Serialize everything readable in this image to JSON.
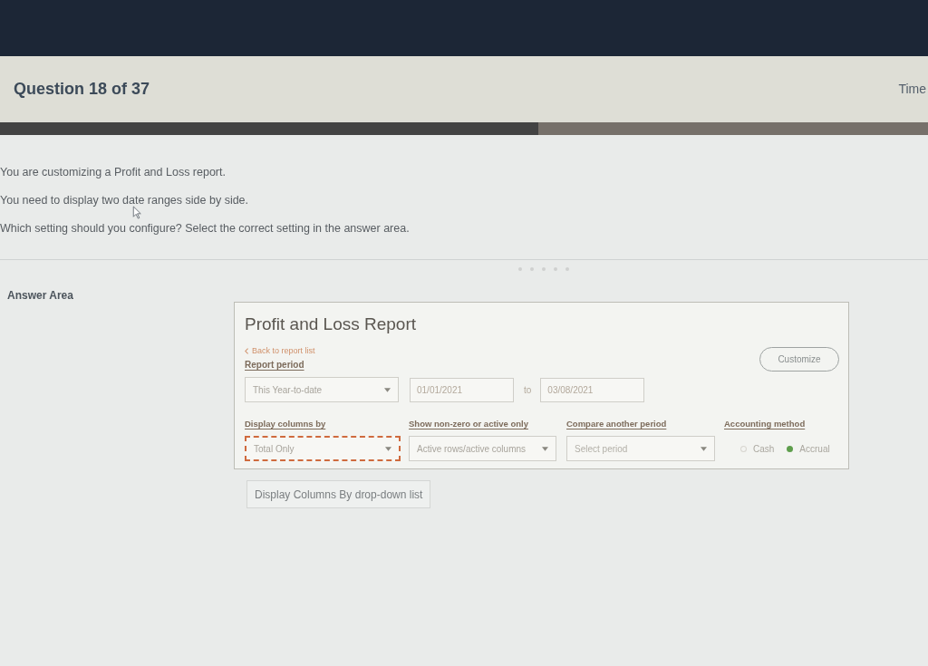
{
  "header": {
    "question": "Question 18 of 37",
    "timer_label": "Time"
  },
  "progress": {
    "level": 0.58
  },
  "question_lines": [
    "You are customizing a Profit and Loss report.",
    "You need to display two date ranges side by side.",
    "Which setting should you configure? Select the correct setting in the answer area."
  ],
  "answer_area": {
    "label": "Answer Area",
    "report": {
      "title": "Profit and Loss Report",
      "back_link": "Back to report list",
      "report_period": {
        "label": "Report period",
        "period_select": "This Year-to-date",
        "start_date": "01/01/2021",
        "to": "to",
        "end_date": "03/08/2021"
      },
      "customize_button": "Customize",
      "settings": [
        {
          "kind": "select",
          "label": "Display columns by",
          "value": "Total Only",
          "highlighted": true
        },
        {
          "kind": "select",
          "label": "Show non-zero or active only",
          "value": "Active rows/active columns",
          "highlighted": false
        },
        {
          "kind": "select",
          "label": "Compare another period",
          "placeholder": "Select period",
          "highlighted": false
        },
        {
          "kind": "radio",
          "label": "Accounting method",
          "options": [
            {
              "label": "Cash",
              "selected": false
            },
            {
              "label": "Accrual",
              "selected": true
            }
          ]
        }
      ]
    },
    "answer_choice": "Display Columns By drop-down list"
  }
}
